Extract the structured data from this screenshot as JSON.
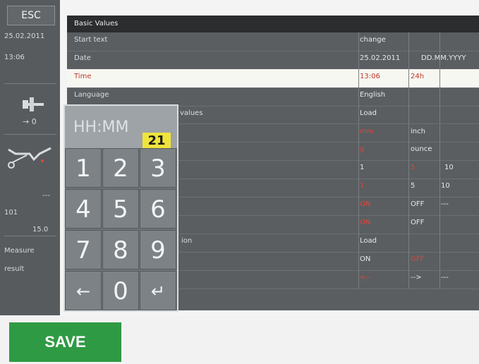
{
  "sidebar": {
    "esc_label": "ESC",
    "date": "25.02.2011",
    "time": "13:06",
    "arrow_value": "→ 0",
    "dash": "---",
    "value_a": "101",
    "value_b": "15.0",
    "measure_label": "Measure",
    "result_label": "result"
  },
  "table": {
    "title": "Basic Values",
    "rows": [
      {
        "label": "Start text",
        "c1": "change",
        "c2": "",
        "c3": ""
      },
      {
        "label": "Date",
        "c1": "25.02.2011",
        "c2": "DD.MM.YYYY",
        "c3": ""
      },
      {
        "label": "Time",
        "c1": "13:06",
        "c2": "24h",
        "c3": ""
      },
      {
        "label": "Language",
        "c1": "English",
        "c2": "",
        "c3": ""
      },
      {
        "label": "values",
        "c1": "Load",
        "c2": "",
        "c3": ""
      },
      {
        "label": "",
        "c1": "mm",
        "c2": "inch",
        "c3": ""
      },
      {
        "label": "",
        "c1": "g",
        "c2": "ounce",
        "c3": ""
      },
      {
        "label": "",
        "c1": "1",
        "c2": "5",
        "c3": "10"
      },
      {
        "label": "",
        "c1": "1",
        "c2": "5",
        "c3": "10"
      },
      {
        "label": "",
        "c1": "ON",
        "c2": "OFF",
        "c3": "---"
      },
      {
        "label": "",
        "c1": "ON",
        "c2": "OFF",
        "c3": ""
      },
      {
        "label": "ion",
        "c1": "Load",
        "c2": "",
        "c3": ""
      },
      {
        "label": "",
        "c1": "ON",
        "c2": "OFF",
        "c3": ""
      },
      {
        "label": "",
        "c1": "<--",
        "c2": "-->",
        "c3": "---"
      }
    ]
  },
  "keypad": {
    "format": "HH:MM",
    "entered": "21",
    "keys": [
      "1",
      "2",
      "3",
      "4",
      "5",
      "6",
      "7",
      "8",
      "9",
      "←",
      "0",
      "↵"
    ]
  },
  "bottom": {
    "save_label": "SAVE"
  },
  "colors": {
    "save_green": "#2f9a44",
    "badge_yellow": "#f0e43a",
    "highlight_red": "#e0443a"
  }
}
